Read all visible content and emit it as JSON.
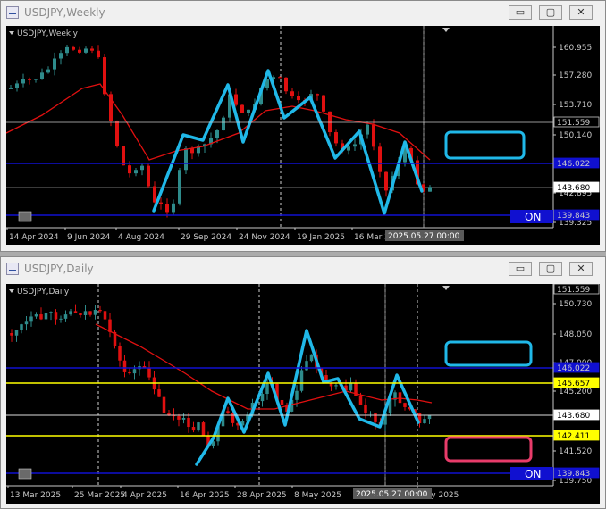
{
  "weekly": {
    "window_title": "USDJPY,Weekly",
    "chart_label": "USDJPY,Weekly",
    "buttons": {
      "minimize": "▭",
      "maximize": "▢",
      "close": "✕"
    },
    "price_labels": [
      "160.955",
      "157.280",
      "153.710",
      "150.140",
      "142.895",
      "139.325"
    ],
    "highlighted_prices": [
      {
        "text": "151.559",
        "bg": "#000000",
        "fg": "#c8c8c8"
      },
      {
        "text": "146.022",
        "bg": "#1010d0",
        "fg": "#c8c8c8"
      },
      {
        "text": "143.680",
        "bg": "#ffffff",
        "fg": "#000000"
      },
      {
        "text": "139.843",
        "bg": "#1010d0",
        "fg": "#c8c8c8"
      }
    ],
    "date_labels": [
      "14 Apr 2024",
      "9 Jun 2024",
      "4 Aug 2024",
      "29 Sep 2024",
      "24 Nov 2024",
      "19 Jan 2025",
      "16 Mar 20"
    ],
    "cursor_time": "2025.05.27 00:00",
    "on_button": "ON"
  },
  "daily": {
    "window_title": "USDJPY,Daily",
    "chart_label": "USDJPY,Daily",
    "buttons": {
      "minimize": "▭",
      "maximize": "▢",
      "close": "✕"
    },
    "price_labels": [
      "150.730",
      "148.050",
      "147.000",
      "145.200",
      "141.520",
      "139.750"
    ],
    "highlighted_prices": [
      {
        "text": "151.559",
        "bg": "#000000",
        "fg": "#c8c8c8"
      },
      {
        "text": "146.022",
        "bg": "#1010d0",
        "fg": "#c8c8c8"
      },
      {
        "text": "145.657",
        "bg": "#ffff00",
        "fg": "#000000"
      },
      {
        "text": "143.680",
        "bg": "#ffffff",
        "fg": "#000000"
      },
      {
        "text": "142.411",
        "bg": "#ffff00",
        "fg": "#000000"
      },
      {
        "text": "139.843",
        "bg": "#1010d0",
        "fg": "#c8c8c8"
      }
    ],
    "date_labels": [
      "13 Mar 2025",
      "25 Mar 2025",
      "4 Apr 2025",
      "16 Apr 2025",
      "28 Apr 2025",
      "8 May 2025",
      "May 2025"
    ],
    "cursor_time": "2025.05.27 00:00",
    "on_button": "ON"
  },
  "colors": {
    "bull": "#2e8b8b",
    "bear": "#e01010",
    "ma": "#e01010",
    "zigzag": "#20b8e8",
    "hline_blue": "#1010d0",
    "hline_yellow": "#ffff00",
    "box_blue": "#20b8e8",
    "box_pink": "#e83c6a"
  }
}
